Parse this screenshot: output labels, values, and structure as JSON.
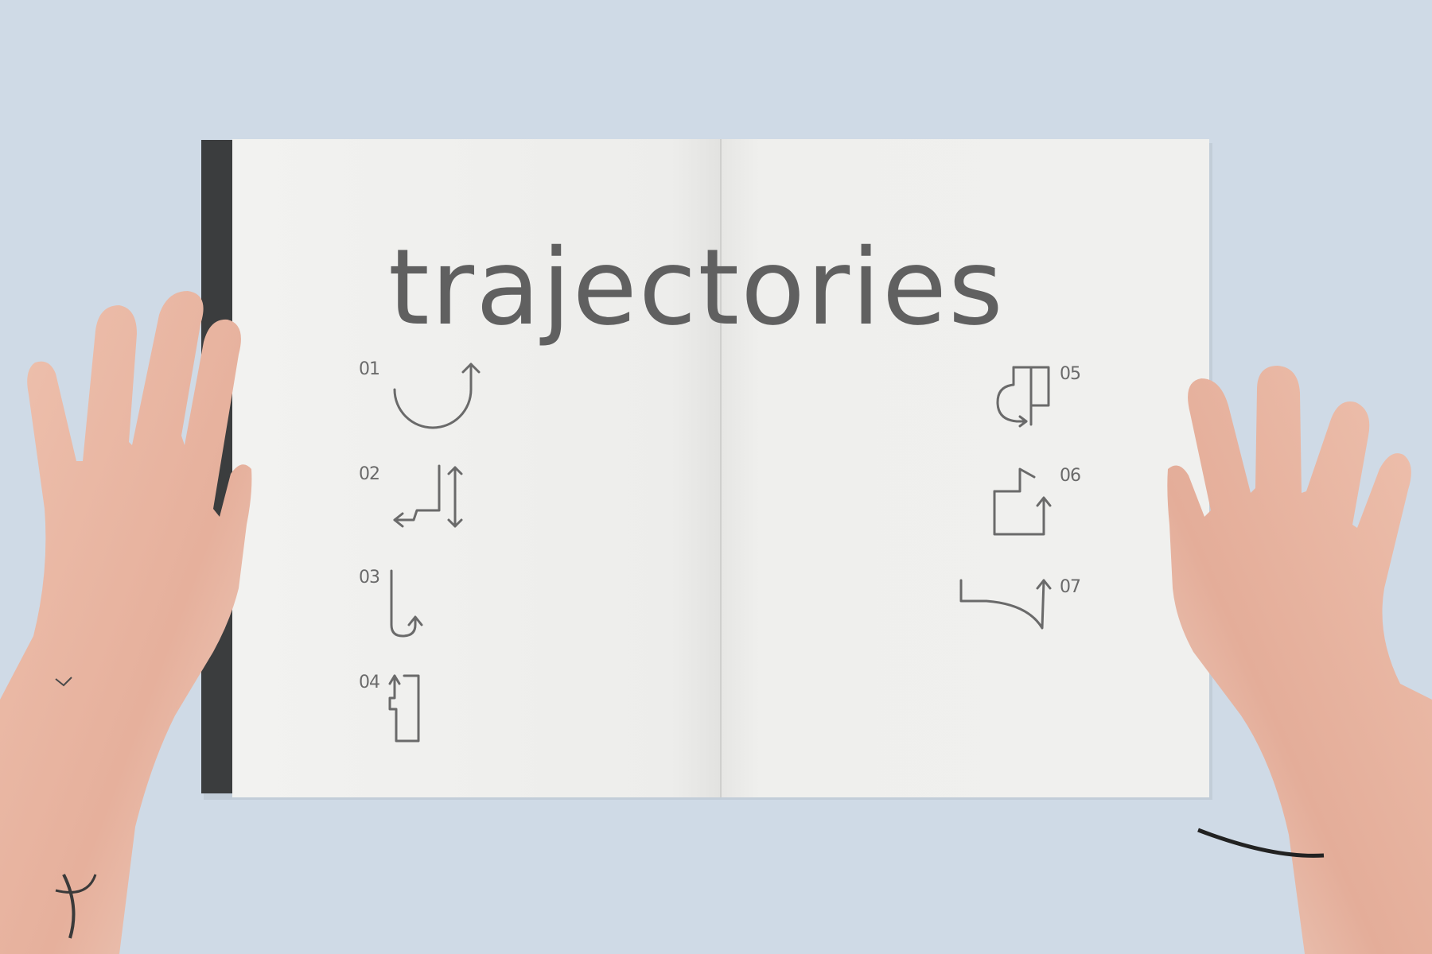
{
  "booklet": {
    "title": "trajectories",
    "items": [
      {
        "number": "01",
        "icon": "half-circle-arrow-icon"
      },
      {
        "number": "02",
        "icon": "stair-double-arrow-icon"
      },
      {
        "number": "03",
        "icon": "hook-arrow-icon"
      },
      {
        "number": "04",
        "icon": "notched-rectangle-arrow-icon"
      },
      {
        "number": "05",
        "icon": "loop-path-arrow-icon"
      },
      {
        "number": "06",
        "icon": "open-box-arrow-icon"
      },
      {
        "number": "07",
        "icon": "curved-tray-arrow-icon"
      }
    ]
  },
  "colors": {
    "background": "#cfdae6",
    "paper": "#eeeeec",
    "ink": "#606060",
    "cover_spine": "#3b3d3e",
    "skin": "#e8b8a6"
  }
}
